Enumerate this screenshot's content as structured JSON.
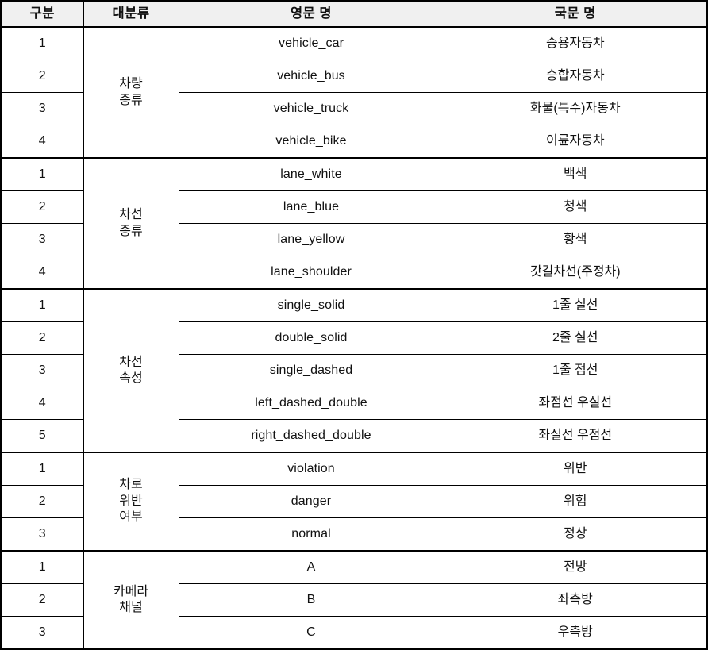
{
  "table": {
    "headers": [
      {
        "key": "id",
        "label": "구분"
      },
      {
        "key": "group",
        "label": "대분류"
      },
      {
        "key": "eng",
        "label": "영문 명"
      },
      {
        "key": "kor",
        "label": "국문 명"
      }
    ],
    "header_background": "#f0f0f0",
    "border_color": "#000000",
    "groups": [
      {
        "group_label": "차량\n종류",
        "rows": [
          {
            "id": "1",
            "eng": "vehicle_car",
            "kor": "승용자동차"
          },
          {
            "id": "2",
            "eng": "vehicle_bus",
            "kor": "승합자동차"
          },
          {
            "id": "3",
            "eng": "vehicle_truck",
            "kor": "화물(특수)자동차"
          },
          {
            "id": "4",
            "eng": "vehicle_bike",
            "kor": "이륜자동차"
          }
        ]
      },
      {
        "group_label": "차선\n종류",
        "rows": [
          {
            "id": "1",
            "eng": "lane_white",
            "kor": "백색"
          },
          {
            "id": "2",
            "eng": "lane_blue",
            "kor": "청색"
          },
          {
            "id": "3",
            "eng": "lane_yellow",
            "kor": "황색"
          },
          {
            "id": "4",
            "eng": "lane_shoulder",
            "kor": "갓길차선(주정차)"
          }
        ]
      },
      {
        "group_label": "차선\n속성",
        "rows": [
          {
            "id": "1",
            "eng": "single_solid",
            "kor": "1줄 실선"
          },
          {
            "id": "2",
            "eng": "double_solid",
            "kor": "2줄 실선"
          },
          {
            "id": "3",
            "eng": "single_dashed",
            "kor": "1줄 점선"
          },
          {
            "id": "4",
            "eng": "left_dashed_double",
            "kor": "좌점선 우실선"
          },
          {
            "id": "5",
            "eng": "right_dashed_double",
            "kor": "좌실선 우점선"
          }
        ]
      },
      {
        "group_label": "차로\n위반\n여부",
        "rows": [
          {
            "id": "1",
            "eng": "violation",
            "kor": "위반"
          },
          {
            "id": "2",
            "eng": "danger",
            "kor": "위험"
          },
          {
            "id": "3",
            "eng": "normal",
            "kor": "정상"
          }
        ]
      },
      {
        "group_label": "카메라\n채널",
        "rows": [
          {
            "id": "1",
            "eng": "A",
            "kor": "전방"
          },
          {
            "id": "2",
            "eng": "B",
            "kor": "좌측방"
          },
          {
            "id": "3",
            "eng": "C",
            "kor": "우측방"
          }
        ]
      }
    ]
  }
}
